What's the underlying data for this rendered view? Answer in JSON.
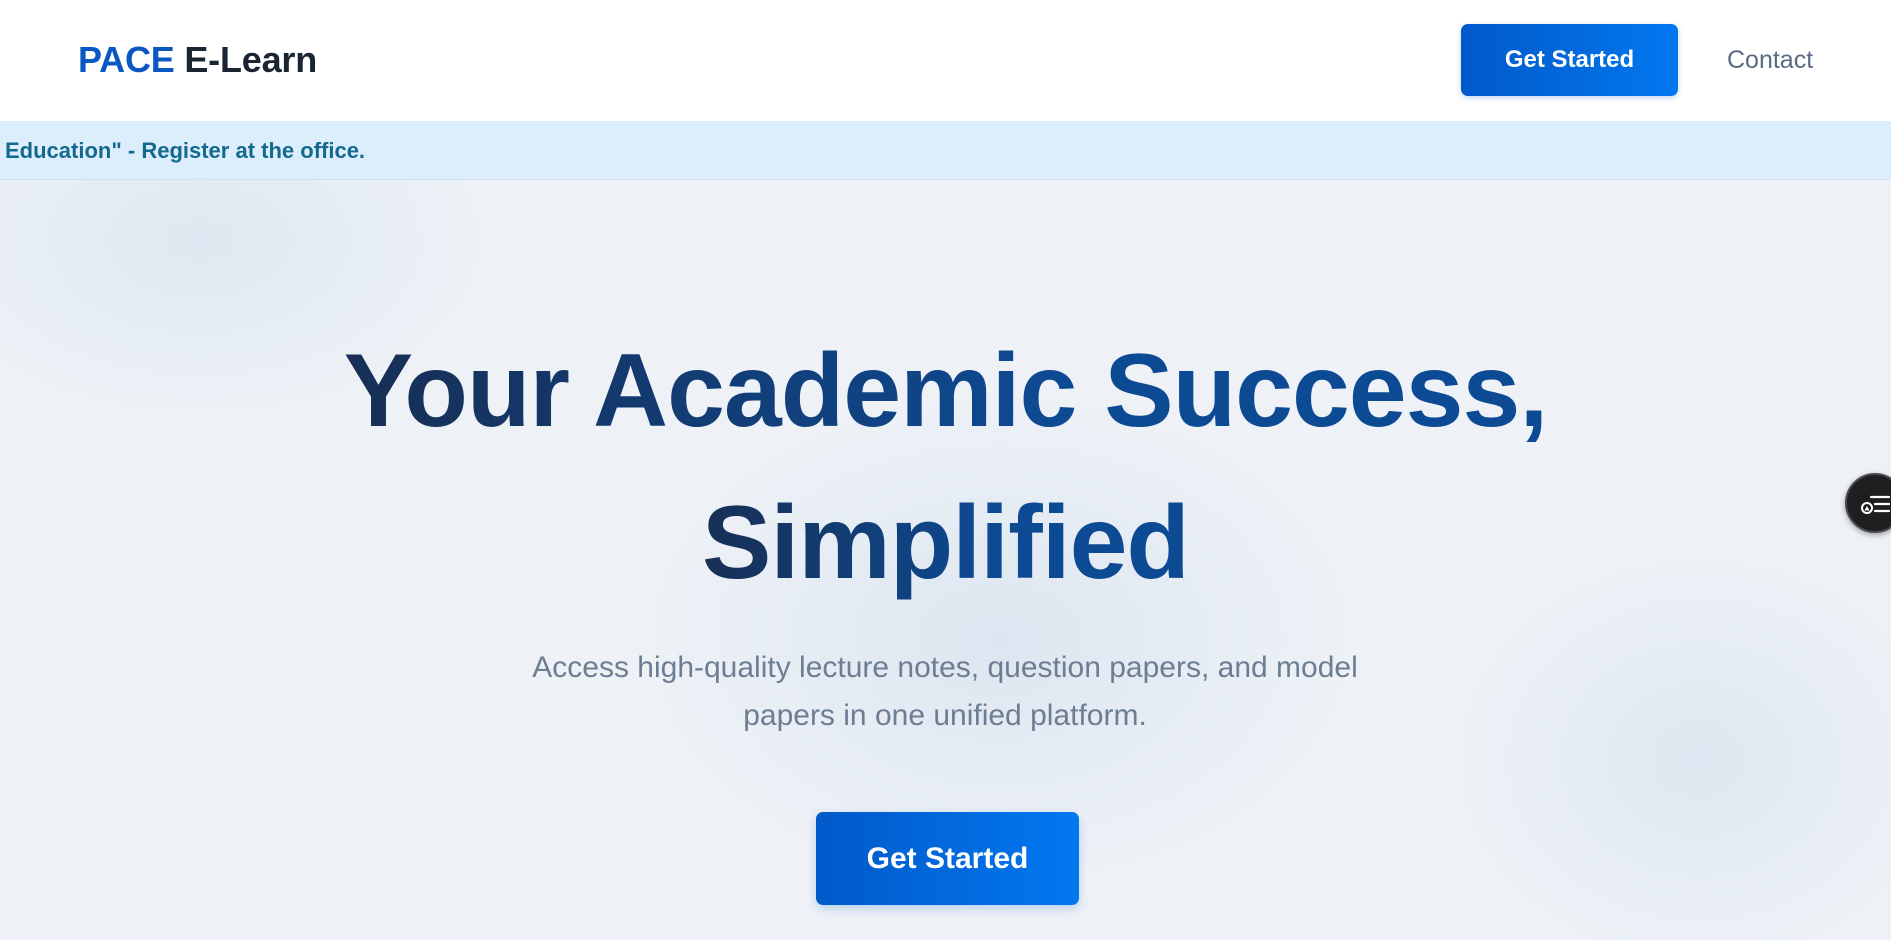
{
  "nav": {
    "brand_accent": "PACE",
    "brand_rest": "E-Learn",
    "cta_label": "Get Started",
    "contact_label": "Contact"
  },
  "announcement": {
    "text": "Education\" - Register at the office."
  },
  "hero": {
    "title_line1": "Your Academic Success,",
    "title_line2": "Simplified",
    "subtitle": "Access high-quality lecture notes, question papers, and model papers in one unified platform.",
    "cta_label": "Get Started"
  },
  "floating_widget": {
    "icon": "reading-list-icon"
  },
  "colors": {
    "brand_blue": "#0a57c2",
    "button_gradient_start": "#0159c9",
    "button_gradient_end": "#0278f0",
    "announcement_bg": "#dceefb",
    "announcement_text": "#14698f",
    "hero_bg": "#eef2f7",
    "title_color": "#163a6e"
  }
}
